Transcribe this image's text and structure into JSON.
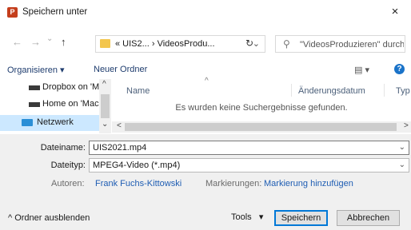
{
  "window": {
    "title": "Speichern unter",
    "close_glyph": "×",
    "app_icon_letter": "P"
  },
  "nav": {
    "back_glyph": "←",
    "forward_glyph": "→",
    "recent_glyph": "⌄",
    "up_glyph": "↑",
    "breadcrumb": "« UIS2... › VideosProdu...",
    "breadcrumb_chevron": "⌄",
    "refresh_glyph": "↻",
    "search_icon_glyph": "⚲",
    "search_placeholder": "\"VideosProduzieren\" durchs..."
  },
  "toolbar": {
    "organize": "Organisieren ▾",
    "new_folder": "Neuer Ordner",
    "view_glyph": "▤ ▾",
    "help": "?"
  },
  "navpane": {
    "items": [
      {
        "label": "Dropbox on 'Ma"
      },
      {
        "label": "Home on 'Mac'"
      },
      {
        "label": "Netzwerk"
      }
    ],
    "scroll_up": "^",
    "scroll_down": "⌄"
  },
  "filelist": {
    "columns": {
      "name": "Name",
      "date": "Änderungsdatum",
      "type": "Typ"
    },
    "sort_glyph": "^",
    "empty_message": "Es wurden keine Suchergebnisse gefunden.",
    "scroll_left": "<",
    "scroll_right": ">"
  },
  "form": {
    "filename_label": "Dateiname:",
    "filename_value": "UIS2021.mp4",
    "filetype_label": "Dateityp:",
    "filetype_value": "MPEG4-Video (*.mp4)",
    "authors_label": "Autoren:",
    "authors_value": "Frank Fuchs-Kittowski",
    "tags_label": "Markierungen:",
    "tags_value": "Markierung hinzufügen",
    "dropdown_glyph": "⌄"
  },
  "footer": {
    "hide_folders": "^  Ordner ausblenden",
    "tools": "Tools   ▾",
    "save": "Speichern",
    "cancel": "Abbrechen"
  }
}
